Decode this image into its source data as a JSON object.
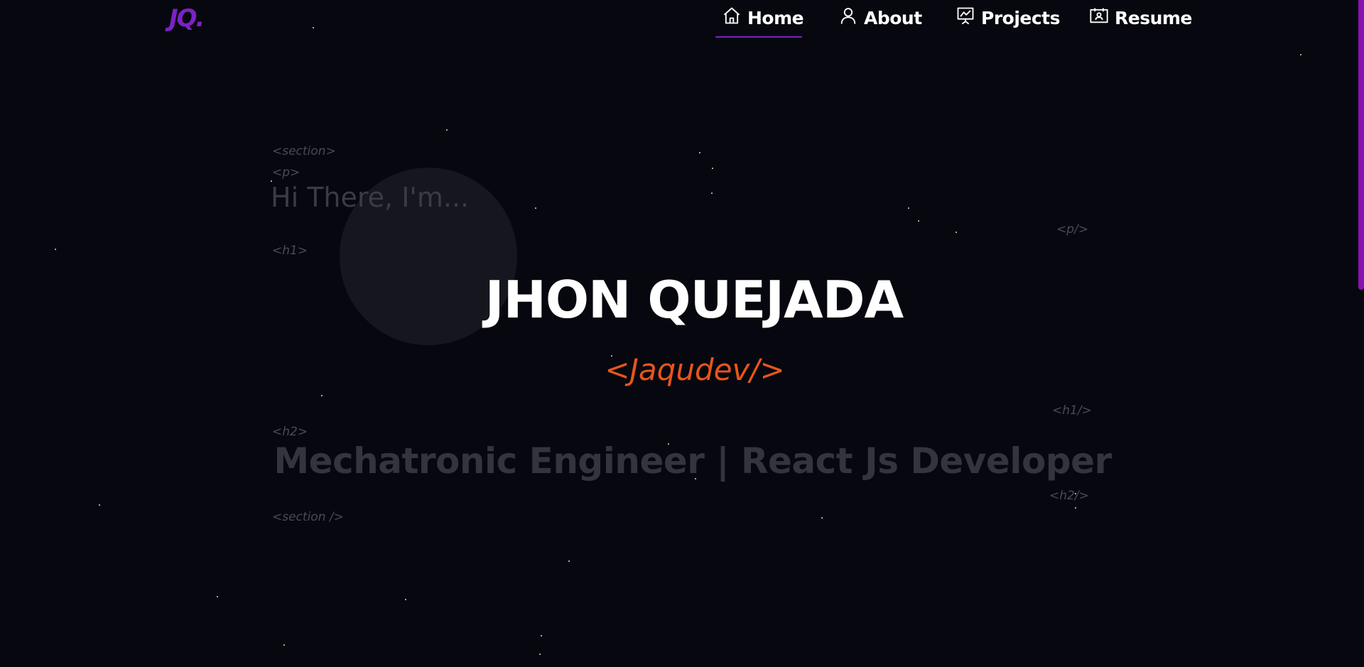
{
  "logo": "JQ.",
  "nav": {
    "items": [
      {
        "label": "Home",
        "icon": "home-icon"
      },
      {
        "label": "About",
        "icon": "user-icon"
      },
      {
        "label": "Projects",
        "icon": "presentation-icon"
      },
      {
        "label": "Resume",
        "icon": "resume-icon"
      }
    ],
    "active": "Home"
  },
  "hero": {
    "tag_section_open": "<section>",
    "tag_p_open": "<p>",
    "greeting": "Hi There, I'm...",
    "tag_p_close": "<p/>",
    "tag_h1_open": "<h1>",
    "name": "JHON QUEJADA",
    "handle": "<Jaqudev/>",
    "tag_h1_close": "<h1/>",
    "tag_h2_open": "<h2>",
    "role": "Mechatronic Engineer | React Js Developer",
    "tag_h2_close": "<h2/>",
    "tag_section_close": "<section />"
  },
  "colors": {
    "background": "#07070f",
    "accent": "#7b22c4",
    "handle": "#e6561a",
    "scrollbar": "#8a12b0"
  }
}
